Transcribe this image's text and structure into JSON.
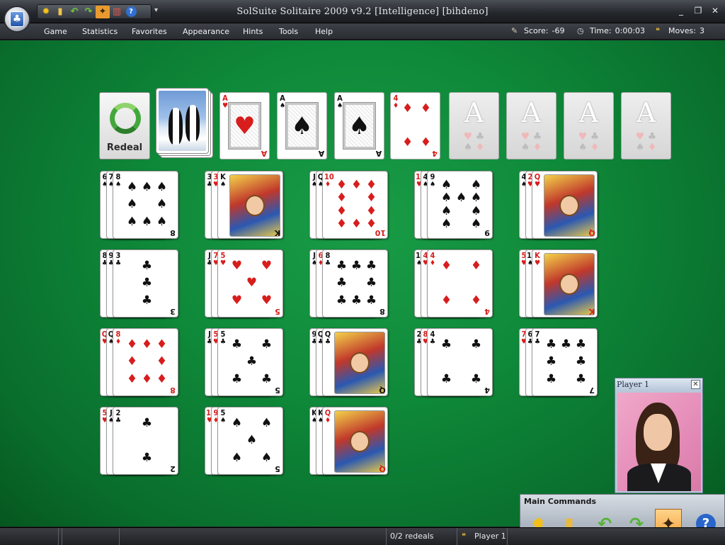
{
  "window": {
    "title": "SolSuite Solitaire 2009 v9.2  [Intelligence]  [bihdeno]",
    "controls": [
      "_",
      "❐",
      "✕"
    ]
  },
  "quick_access": [
    "new-game",
    "open",
    "undo",
    "redo",
    "hint-wand",
    "statistics",
    "help"
  ],
  "menu": [
    "Game",
    "Statistics",
    "Favorites",
    "Appearance",
    "Hints",
    "Tools",
    "Help"
  ],
  "stats": {
    "score_label": "Score:",
    "score_value": "-69",
    "time_label": "Time:",
    "time_value": "0:00:03",
    "moves_label": "Moves:",
    "moves_value": "3"
  },
  "redeal": {
    "label": "Redeal"
  },
  "foundations": [
    {
      "rank": "A",
      "suit": "♥",
      "color": "red"
    },
    {
      "rank": "A",
      "suit": "♠",
      "color": "black"
    },
    {
      "rank": "A",
      "suit": "♠",
      "color": "black"
    },
    {
      "rank": "4",
      "suit": "♦",
      "color": "red"
    },
    {
      "rank": "A",
      "empty": true
    },
    {
      "rank": "A",
      "empty": true
    },
    {
      "rank": "A",
      "empty": true
    },
    {
      "rank": "A",
      "empty": true
    }
  ],
  "empty_foundation_suits": [
    "♥",
    "♣",
    "♠",
    "♦"
  ],
  "tableau": [
    [
      {
        "under": [
          [
            "6",
            "♠",
            "b"
          ],
          [
            "7",
            "♠",
            "b"
          ]
        ],
        "top": [
          "8",
          "♠",
          "b"
        ]
      },
      {
        "under": [
          [
            "3",
            "♣",
            "b"
          ],
          [
            "3",
            "♥",
            "r"
          ]
        ],
        "top": [
          "K",
          "♠",
          "b"
        ],
        "face": true
      },
      {
        "under": [
          [
            "J",
            "♠",
            "b"
          ],
          [
            "Q",
            "♠",
            "b"
          ]
        ],
        "top": [
          "10",
          "♦",
          "r"
        ]
      },
      {
        "under": [
          [
            "10",
            "♥",
            "r"
          ],
          [
            "4",
            "♠",
            "b"
          ]
        ],
        "top": [
          "9",
          "♠",
          "b"
        ]
      },
      {
        "under": [
          [
            "4",
            "♠",
            "b"
          ],
          [
            "2",
            "♥",
            "r"
          ]
        ],
        "top": [
          "Q",
          "♥",
          "r"
        ],
        "face": true
      }
    ],
    [
      {
        "under": [
          [
            "8",
            "♣",
            "b"
          ],
          [
            "9",
            "♣",
            "b"
          ]
        ],
        "top": [
          "3",
          "♣",
          "b"
        ]
      },
      {
        "under": [
          [
            "J",
            "♣",
            "b"
          ],
          [
            "7",
            "♥",
            "r"
          ]
        ],
        "top": [
          "5",
          "♥",
          "r"
        ]
      },
      {
        "under": [
          [
            "J",
            "♠",
            "b"
          ],
          [
            "6",
            "♦",
            "r"
          ]
        ],
        "top": [
          "8",
          "♣",
          "b"
        ]
      },
      {
        "under": [
          [
            "10",
            "♠",
            "b"
          ],
          [
            "4",
            "♥",
            "r"
          ]
        ],
        "top": [
          "4",
          "♦",
          "r"
        ]
      },
      {
        "under": [
          [
            "5",
            "♥",
            "r"
          ],
          [
            "10",
            "♠",
            "b"
          ]
        ],
        "top": [
          "K",
          "♥",
          "r"
        ],
        "face": true
      }
    ],
    [
      {
        "under": [
          [
            "Q",
            "♥",
            "r"
          ],
          [
            "Q",
            "♠",
            "b"
          ]
        ],
        "top": [
          "8",
          "♦",
          "r"
        ]
      },
      {
        "under": [
          [
            "J",
            "♣",
            "b"
          ],
          [
            "5",
            "♥",
            "r"
          ]
        ],
        "top": [
          "5",
          "♣",
          "b"
        ]
      },
      {
        "under": [
          [
            "9",
            "♣",
            "b"
          ],
          [
            "Q",
            "♣",
            "b"
          ]
        ],
        "top": [
          "Q",
          "♣",
          "b"
        ],
        "face": true
      },
      {
        "under": [
          [
            "2",
            "♣",
            "b"
          ],
          [
            "8",
            "♥",
            "r"
          ]
        ],
        "top": [
          "4",
          "♣",
          "b"
        ]
      },
      {
        "under": [
          [
            "7",
            "♥",
            "r"
          ],
          [
            "6",
            "♣",
            "b"
          ]
        ],
        "top": [
          "7",
          "♣",
          "b"
        ]
      }
    ],
    [
      {
        "under": [
          [
            "5",
            "♥",
            "r"
          ],
          [
            "J",
            "♠",
            "b"
          ]
        ],
        "top": [
          "2",
          "♣",
          "b"
        ]
      },
      {
        "under": [
          [
            "10",
            "♥",
            "r"
          ],
          [
            "9",
            "♦",
            "r"
          ]
        ],
        "top": [
          "5",
          "♠",
          "b"
        ]
      },
      {
        "under": [
          [
            "K",
            "♠",
            "b"
          ],
          [
            "K",
            "♠",
            "b"
          ]
        ],
        "top": [
          "Q",
          "♦",
          "r"
        ],
        "face": true
      },
      null,
      null
    ]
  ],
  "player_panel": {
    "title": "Player 1",
    "close": "✕"
  },
  "main_commands": {
    "title": "Main Commands",
    "buttons": [
      "new-game",
      "open",
      "undo",
      "redo",
      "hint-wand",
      "help"
    ]
  },
  "status": {
    "redeals": "0/2 redeals",
    "player": "Player 1"
  }
}
